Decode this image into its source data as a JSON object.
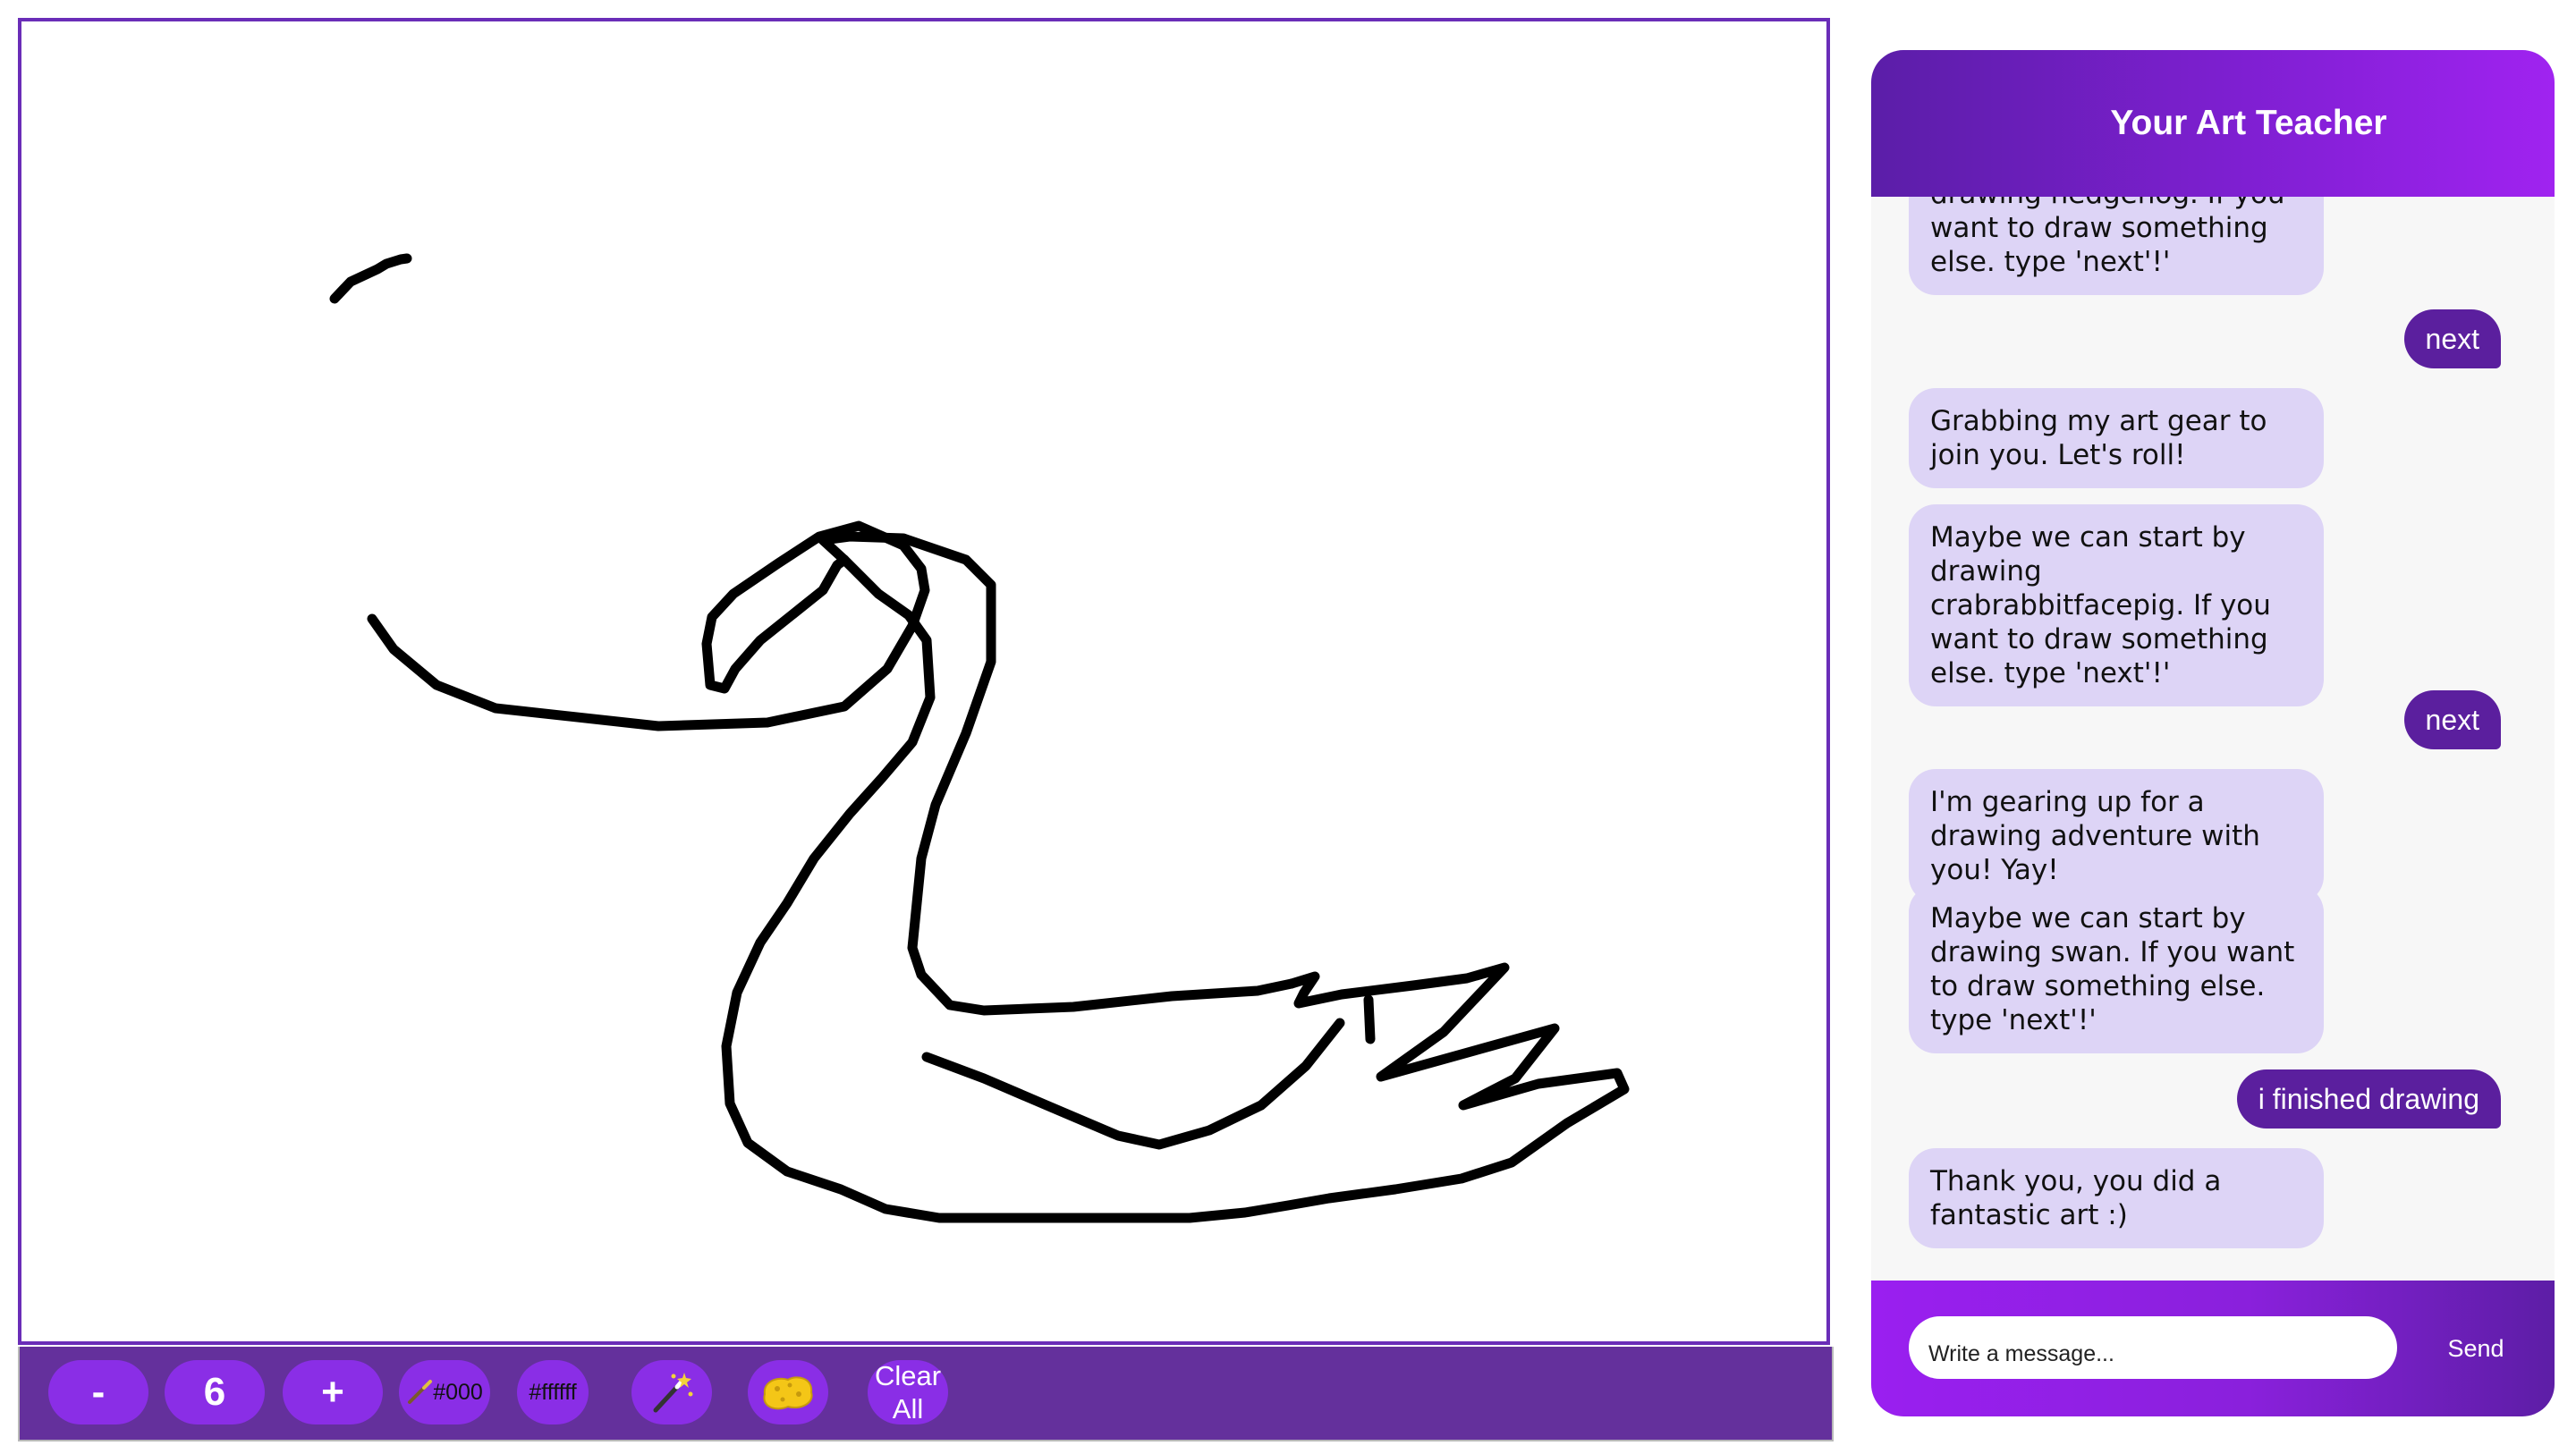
{
  "toolbar": {
    "decrease_label": "-",
    "brush_size": "6",
    "increase_label": "+",
    "color_black_label": "#000",
    "color_white_label": "#ffffff",
    "clear_all_line1": "Clear",
    "clear_all_line2": "All",
    "icons": [
      "brush-icon",
      "brush-icon",
      "magic-wand-icon",
      "sponge-icon"
    ]
  },
  "chat": {
    "title": "Your Art Teacher",
    "messages": [
      {
        "sender": "teacher",
        "text": "drawing hedgehog. If you want to draw something else. type 'next'!'"
      },
      {
        "sender": "user",
        "text": "next"
      },
      {
        "sender": "teacher",
        "text": "Grabbing my art gear to join you. Let's roll!"
      },
      {
        "sender": "teacher",
        "text": "Maybe we can start by drawing crabrabbitfacepig. If you want to draw something else. type 'next'!'"
      },
      {
        "sender": "user",
        "text": "next"
      },
      {
        "sender": "teacher",
        "text": "I'm gearing up for a drawing adventure with you! Yay!"
      },
      {
        "sender": "teacher",
        "text": "Maybe we can start by drawing swan. If you want to draw something else. type 'next'!'"
      },
      {
        "sender": "user",
        "text": "i finished drawing"
      },
      {
        "sender": "teacher",
        "text": "Thank you, you did a fantastic art :)"
      }
    ],
    "input_placeholder": "Write a message...",
    "send_label": "Send"
  },
  "colors": {
    "accent": "#8a2ee6",
    "toolbar_bg": "#64309c",
    "teacher_bubble": "#ddd4f6",
    "user_bubble": "#5b1f9e",
    "canvas_border": "#6a2db8"
  }
}
